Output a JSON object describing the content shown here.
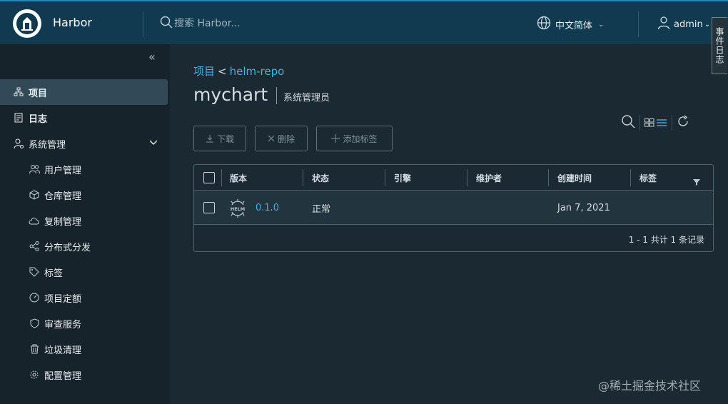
{
  "header": {
    "brand": "Harbor",
    "search_placeholder": "搜索 Harbor...",
    "language": "中文简体",
    "user": "admin",
    "event_tab": "事件日志"
  },
  "sidebar": {
    "items": [
      {
        "label": "项目",
        "icon": "project-icon",
        "active": true
      },
      {
        "label": "日志",
        "icon": "log-icon"
      },
      {
        "label": "系统管理",
        "icon": "admin-icon",
        "expanded": true
      }
    ],
    "sub_items": [
      {
        "label": "用户管理",
        "icon": "users-icon"
      },
      {
        "label": "仓库管理",
        "icon": "cube-icon"
      },
      {
        "label": "复制管理",
        "icon": "cloud-icon"
      },
      {
        "label": "分布式分发",
        "icon": "share-icon"
      },
      {
        "label": "标签",
        "icon": "tag-icon"
      },
      {
        "label": "项目定额",
        "icon": "gauge-icon"
      },
      {
        "label": "审查服务",
        "icon": "shield-icon"
      },
      {
        "label": "垃圾清理",
        "icon": "trash-icon"
      },
      {
        "label": "配置管理",
        "icon": "gear-icon"
      }
    ]
  },
  "main": {
    "breadcrumb": {
      "parent": "项目",
      "separator": "<",
      "current": "helm-repo"
    },
    "title": "mychart",
    "role": "系统管理员",
    "buttons": {
      "download": "下载",
      "delete": "删除",
      "add_label": "添加标签"
    },
    "table": {
      "columns": [
        "版本",
        "状态",
        "引擎",
        "维护者",
        "创建时间",
        "标签"
      ],
      "rows": [
        {
          "version": "0.1.0",
          "status": "正常",
          "engine": "",
          "maintainer": "",
          "created": "Jan 7, 2021",
          "labels": ""
        }
      ],
      "footer": "1 - 1 共计 1 条记录"
    }
  },
  "watermark": "@稀土掘金技术社区",
  "colors": {
    "accent": "#49aeda",
    "header_bg": "#0f3a4f",
    "sidebar_bg": "#17232a",
    "main_bg": "#1b2a32"
  }
}
